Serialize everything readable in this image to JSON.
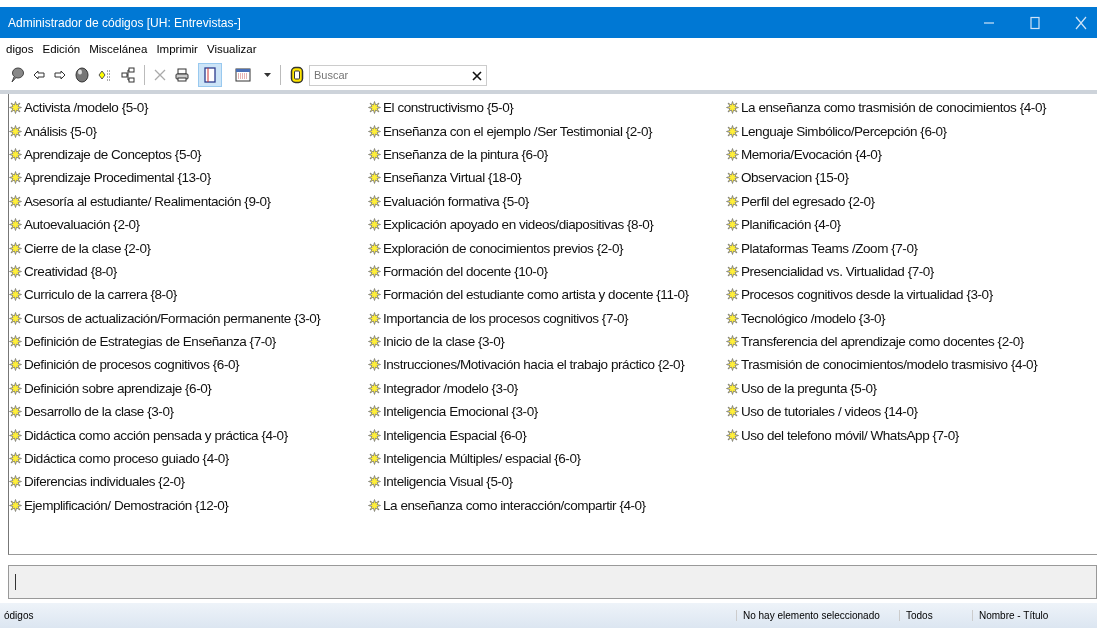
{
  "window": {
    "title": "Administrador de códigos [UH: Entrevistas-]"
  },
  "menu": [
    "digos",
    "Edición",
    "Miscelánea",
    "Imprimir",
    "Visualizar"
  ],
  "toolbar": {
    "view_buttons": [
      {
        "selected": true
      },
      {
        "selected": false
      }
    ]
  },
  "search": {
    "placeholder": "Buscar"
  },
  "codes": [
    "Activista /modelo {5-0}",
    "Análisis {5-0}",
    "Aprendizaje de Conceptos {5-0}",
    "Aprendizaje Procedimental {13-0}",
    "Asesoría al estudiante/ Realimentación {9-0}",
    "Autoevaluación {2-0}",
    "Cierre de la clase {2-0}",
    "Creatividad {8-0}",
    "Curriculo de la carrera {8-0}",
    "Cursos de actualización/Formación permanente {3-0}",
    "Definición de Estrategias de Enseñanza {7-0}",
    "Definición de procesos cognitivos {6-0}",
    "Definición sobre aprendizaje {6-0}",
    "Desarrollo de la clase {3-0}",
    "Didáctica como acción pensada y práctica {4-0}",
    "Didáctica como proceso guiado {4-0}",
    "Diferencias individuales {2-0}",
    "Ejemplificación/ Demostración {12-0}",
    "El constructivismo {5-0}",
    "Enseñanza con el ejemplo /Ser Testimonial {2-0}",
    "Enseñanza de la pintura {6-0}",
    "Enseñanza Virtual {18-0}",
    "Evaluación formativa {5-0}",
    "Explicación apoyado en videos/diapositivas {8-0}",
    "Exploración de conocimientos previos {2-0}",
    "Formación del docente {10-0}",
    "Formación del estudiante como artista y docente {11-0}",
    "Importancia de los procesos cognitivos {7-0}",
    "Inicio de la clase {3-0}",
    "Instrucciones/Motivación hacia el trabajo práctico {2-0}",
    "Integrador /modelo {3-0}",
    "Inteligencia Emocional {3-0}",
    "Inteligencia Espacial {6-0}",
    "Inteligencia Múltiples/ espacial {6-0}",
    "Inteligencia Visual {5-0}",
    "La enseñanza como interacción/compartir {4-0}",
    "La enseñanza como trasmisión de conocimientos {4-0}",
    "Lenguaje Simbólico/Percepción {6-0}",
    "Memoria/Evocación {4-0}",
    "Observacion {15-0}",
    "Perfil del egresado {2-0}",
    "Planificación {4-0}",
    "Plataformas Teams /Zoom {7-0}",
    "Presencialidad vs. Virtualidad {7-0}",
    "Procesos cognitivos desde la virtualidad {3-0}",
    "Tecnológico /modelo {3-0}",
    "Transferencia del aprendizaje como docentes {2-0}",
    "Trasmisión de conocimientos/modelo trasmisivo {4-0}",
    "Uso de la pregunta {5-0}",
    "Uso de tutoriales / videos {14-0}",
    "Uso del telefono móvil/ WhatsApp {7-0}"
  ],
  "status_bar": [
    "ódigos",
    "No hay elemento seleccionado",
    "Todos",
    "Nombre - Título"
  ]
}
